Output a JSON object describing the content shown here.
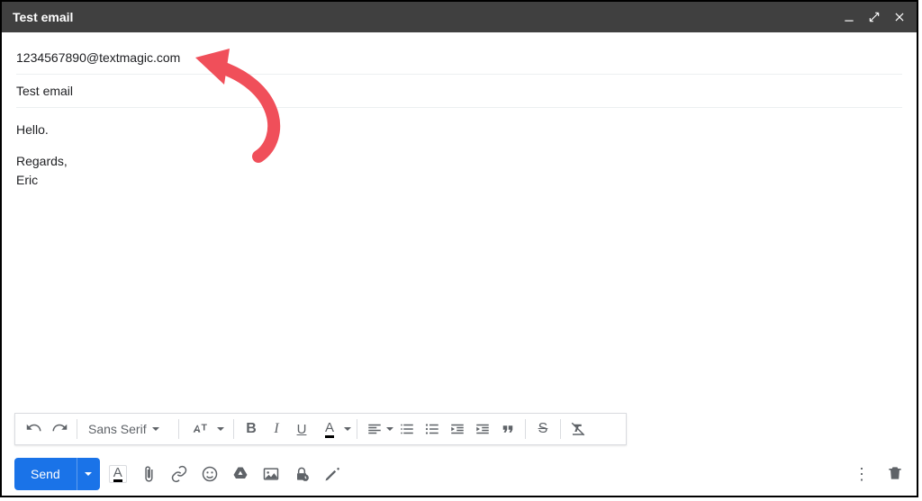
{
  "header": {
    "title": "Test email"
  },
  "to": "1234567890@textmagic.com",
  "subject": "Test email",
  "body": {
    "greeting": "Hello.",
    "signature": "Regards,\nEric"
  },
  "format_toolbar": {
    "font_family": "Sans Serif"
  },
  "send": {
    "label": "Send"
  }
}
